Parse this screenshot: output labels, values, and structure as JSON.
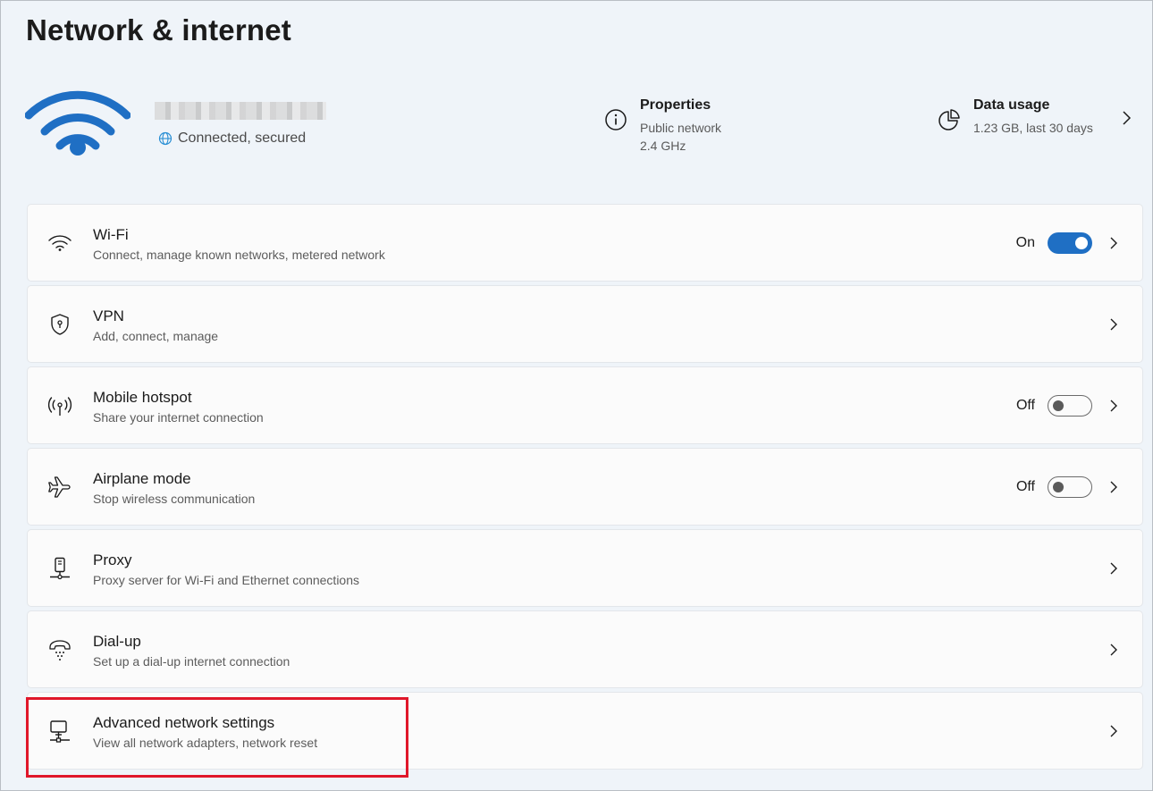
{
  "page": {
    "title": "Network & internet"
  },
  "connection": {
    "status": "Connected, secured"
  },
  "properties": {
    "title": "Properties",
    "lines": [
      "Public network",
      "2.4 GHz"
    ]
  },
  "data_usage": {
    "title": "Data usage",
    "lines": [
      "1.23 GB, last 30 days"
    ]
  },
  "rows": [
    {
      "title": "Wi-Fi",
      "subtitle": "Connect, manage known networks, metered network",
      "icon": "wifi-icon",
      "toggle": "On"
    },
    {
      "title": "VPN",
      "subtitle": "Add, connect, manage",
      "icon": "shield-icon"
    },
    {
      "title": "Mobile hotspot",
      "subtitle": "Share your internet connection",
      "icon": "hotspot-icon",
      "toggle": "Off"
    },
    {
      "title": "Airplane mode",
      "subtitle": "Stop wireless communication",
      "icon": "airplane-icon",
      "toggle": "Off"
    },
    {
      "title": "Proxy",
      "subtitle": "Proxy server for Wi-Fi and Ethernet connections",
      "icon": "proxy-icon"
    },
    {
      "title": "Dial-up",
      "subtitle": "Set up a dial-up internet connection",
      "icon": "phone-icon"
    },
    {
      "title": "Advanced network settings",
      "subtitle": "View all network adapters, network reset",
      "icon": "network-adapter-icon"
    }
  ],
  "colors": {
    "accent": "#1f6fc4",
    "highlight": "#e0172a",
    "background": "#eff4f9"
  }
}
